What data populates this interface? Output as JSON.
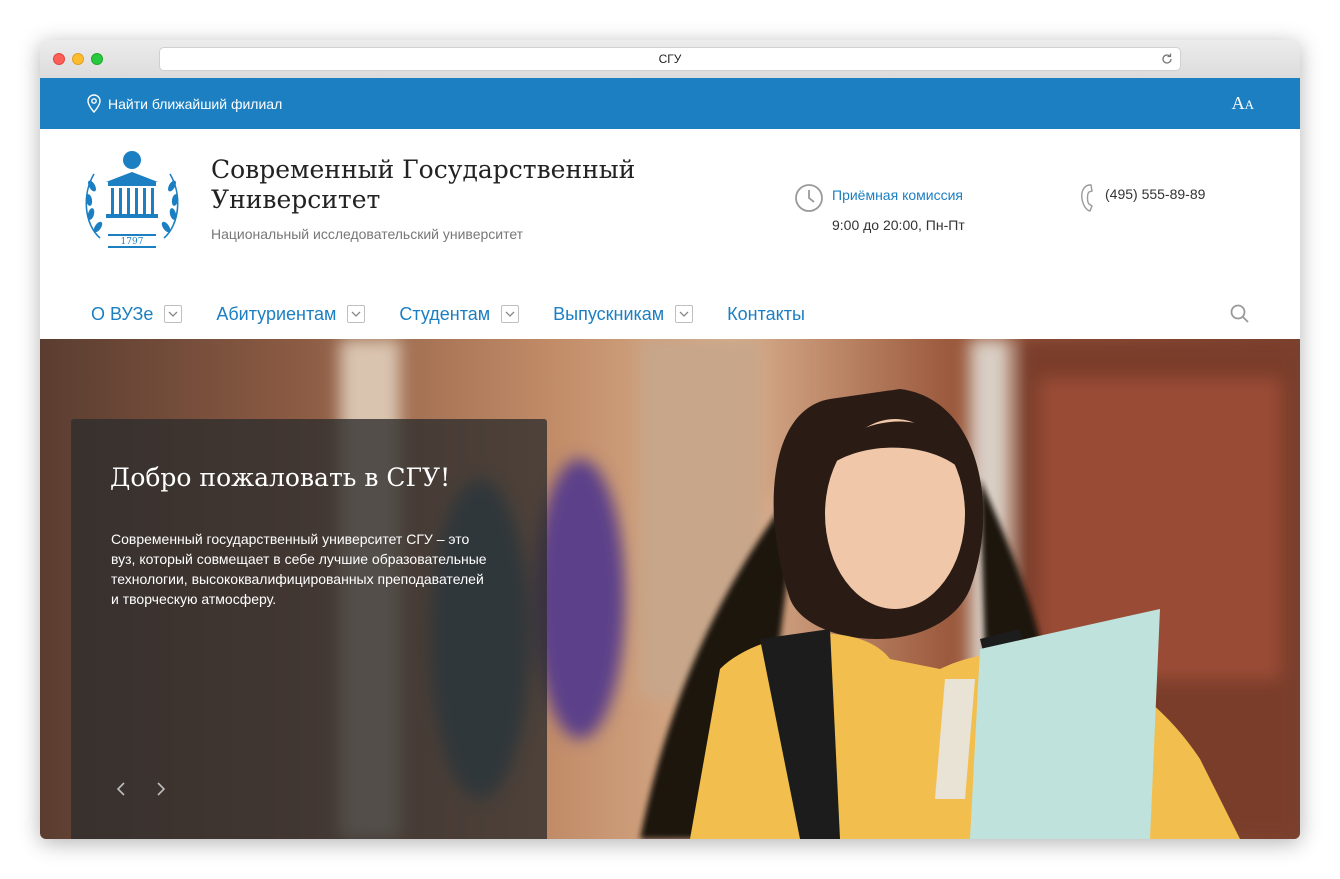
{
  "browser": {
    "url_text": "СГУ"
  },
  "topbar": {
    "branch_label": "Найти ближайший филиал",
    "font_toggle_big": "A",
    "font_toggle_small": "A",
    "bg_color": "#1b7fc2"
  },
  "header": {
    "name_line1": "Современный Государственный",
    "name_line2": "Университет",
    "subtitle": "Национальный исследовательский университет",
    "admission_label": "Приёмная комиссия",
    "admission_hours": "9:00 до 20:00, Пн-Пт",
    "phone": "(495) 555-89-89",
    "logo_year": "1797"
  },
  "nav": {
    "items": [
      {
        "label": "О ВУЗе",
        "has_dropdown": true
      },
      {
        "label": "Абитуриентам",
        "has_dropdown": true
      },
      {
        "label": "Студентам",
        "has_dropdown": true
      },
      {
        "label": "Выпускникам",
        "has_dropdown": true
      },
      {
        "label": "Контакты",
        "has_dropdown": false
      }
    ],
    "search_icon": "search-icon"
  },
  "hero": {
    "title": "Добро пожаловать в СГУ!",
    "text": "Современный государственный университет  СГУ – это  вуз, который совмещает в себе лучшие образовательные технологии, высококвалифицированных преподавателей  и творческую атмосферу.",
    "prev_icon": "chevron-left-icon",
    "next_icon": "chevron-right-icon"
  }
}
